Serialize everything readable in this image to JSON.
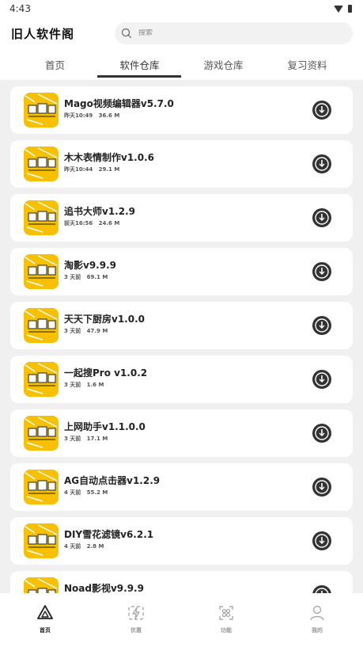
{
  "status_bar": {
    "time": "4:43"
  },
  "header": {
    "title": "旧人软件阁",
    "search_placeholder": "搜索"
  },
  "tabs": [
    {
      "label": "首页"
    },
    {
      "label": "软件仓库",
      "active": true
    },
    {
      "label": "游戏仓库"
    },
    {
      "label": "复习资料"
    }
  ],
  "apps": [
    {
      "name": "Mago视频编辑器v5.7.0",
      "time": "昨天10:49",
      "size": "36.6 M"
    },
    {
      "name": "木木表情制作v1.0.6",
      "time": "昨天10:44",
      "size": "29.1 M"
    },
    {
      "name": "追书大师v1.2.9",
      "time": "前天16:56",
      "size": "24.6 M"
    },
    {
      "name": "淘影v9.9.9",
      "time": "3 天前",
      "size": "69.1 M"
    },
    {
      "name": "天天下厨房v1.0.0",
      "time": "3 天前",
      "size": "47.9 M"
    },
    {
      "name": "一起搜Pro  v1.0.2",
      "time": "3 天前",
      "size": "1.6 M"
    },
    {
      "name": "上网助手v1.1.0.0",
      "time": "3 天前",
      "size": "17.1 M"
    },
    {
      "name": "AG自动点击器v1.2.9",
      "time": "4 天前",
      "size": "55.2 M"
    },
    {
      "name": "DIY雪花滤镜v6.2.1",
      "time": "4 天前",
      "size": "2.8 M"
    },
    {
      "name": "Noad影视v9.9.9",
      "time": "",
      "size": ""
    }
  ],
  "bottom_nav": [
    {
      "label": "首页",
      "icon": "home-triangle-icon",
      "active": true
    },
    {
      "label": "优惠",
      "icon": "lightning-icon"
    },
    {
      "label": "功能",
      "icon": "grid-features-icon"
    },
    {
      "label": "我的",
      "icon": "user-icon"
    }
  ],
  "colors": {
    "accent_icon_bg": "#f7c000",
    "list_bg": "#f0f0f0",
    "download_btn": "#333333"
  }
}
